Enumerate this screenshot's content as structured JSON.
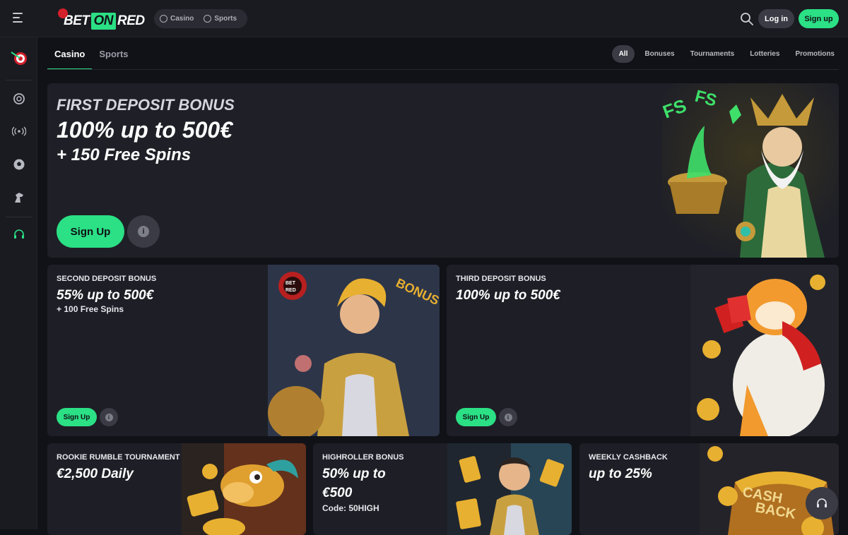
{
  "header": {
    "logo": {
      "bet": "BET",
      "on": "ON",
      "red": "RED"
    },
    "switch": [
      {
        "label": "Casino",
        "icon": "casino-chip-icon"
      },
      {
        "label": "Sports",
        "icon": "soccer-ball-icon"
      }
    ],
    "login_label": "Log in",
    "signup_label": "Sign up"
  },
  "sidebar": {
    "items": [
      {
        "icon": "dart-target-icon"
      },
      {
        "icon": "casino-chip-icon"
      },
      {
        "icon": "live-broadcast-icon"
      },
      {
        "icon": "soccer-ball-icon"
      },
      {
        "icon": "horse-racing-icon"
      },
      {
        "icon": "support-headset-icon"
      }
    ]
  },
  "tabs": [
    {
      "label": "Casino",
      "active": true
    },
    {
      "label": "Sports",
      "active": false
    }
  ],
  "filters": [
    {
      "label": "All",
      "active": true
    },
    {
      "label": "Bonuses",
      "active": false
    },
    {
      "label": "Tournaments",
      "active": false
    },
    {
      "label": "Lotteries",
      "active": false
    },
    {
      "label": "Promotions",
      "active": false
    }
  ],
  "promos": {
    "first": {
      "kicker": "FIRST DEPOSIT BONUS",
      "title": "100% up to 500€",
      "sub": "+ 150 Free Spins",
      "cta": "Sign Up",
      "info": "i"
    },
    "second": {
      "kicker": "SECOND DEPOSIT BONUS",
      "title": "55% up to 500€",
      "sub": "+ 100 Free Spins",
      "cta": "Sign Up",
      "info": "i"
    },
    "third": {
      "kicker": "THIRD DEPOSIT BONUS",
      "title": "100% up to 500€",
      "cta": "Sign Up",
      "info": "i"
    },
    "rookie": {
      "kicker": "ROOKIE RUMBLE TOURNAMENT",
      "title": "€2,500 Daily"
    },
    "highroller": {
      "kicker": "HIGHROLLER BONUS",
      "title_line1": "50% up to",
      "title_line2": "€500",
      "code": "Code: 50HIGH"
    },
    "cashback": {
      "kicker": "WEEKLY CASHBACK",
      "title": "up to 25%",
      "art_text_1": "CASH",
      "art_text_2": "BACK"
    }
  },
  "art_text": {
    "fs": "FS",
    "bonus": "BONUS",
    "bet": "BET",
    "red": "RED"
  },
  "colors": {
    "accent": "#2be085",
    "bg": "#111217",
    "panel": "#1a1b21",
    "card": "#1e1f26",
    "chip": "#3a3b44"
  }
}
